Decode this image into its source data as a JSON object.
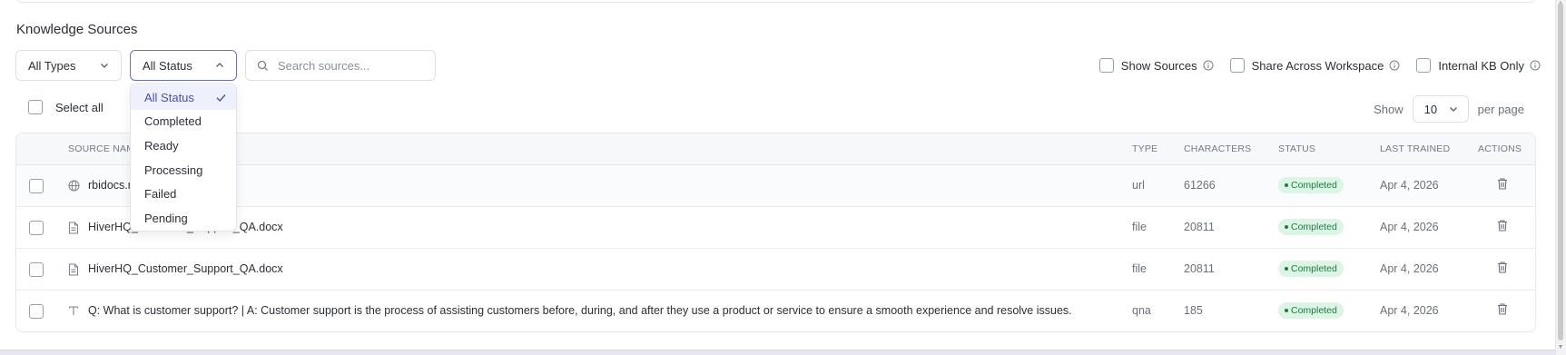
{
  "title": "Knowledge Sources",
  "filters": {
    "types_value": "All Types",
    "status_value": "All Status",
    "search_placeholder": "Search sources...",
    "status_options": [
      "All Status",
      "Completed",
      "Ready",
      "Processing",
      "Failed",
      "Pending"
    ],
    "status_selected": "All Status"
  },
  "toggles": {
    "show_sources": "Show Sources",
    "share_across_workspace": "Share Across Workspace",
    "internal_kb_only": "Internal KB Only"
  },
  "select_all_label": "Select all",
  "pagination": {
    "show_label": "Show",
    "per_page_value": "10",
    "per_page_label": "per page"
  },
  "table": {
    "headers": {
      "source_name": "SOURCE NAME",
      "type": "TYPE",
      "characters": "CHARACTERS",
      "status": "STATUS",
      "last_trained": "LAST TRAINED",
      "actions": "ACTIONS"
    },
    "rows": [
      {
        "icon": "globe-icon",
        "name": "rbidocs.rbi.org.in",
        "type": "url",
        "characters": "61266",
        "status": "Completed",
        "last_trained": "Apr 4, 2026"
      },
      {
        "icon": "file-icon",
        "name": "HiverHQ_Customer_Support_QA.docx",
        "type": "file",
        "characters": "20811",
        "status": "Completed",
        "last_trained": "Apr 4, 2026"
      },
      {
        "icon": "file-icon",
        "name": "HiverHQ_Customer_Support_QA.docx",
        "type": "file",
        "characters": "20811",
        "status": "Completed",
        "last_trained": "Apr 4, 2026"
      },
      {
        "icon": "text-icon",
        "name": "Q: What is customer support? | A: Customer support is the process of assisting customers before, during, and after they use a product or service to ensure a smooth experience and resolve issues.",
        "type": "qna",
        "characters": "185",
        "status": "Completed",
        "last_trained": "Apr 4, 2026"
      }
    ]
  },
  "colors": {
    "accent": "#4a4fb0",
    "status_completed_bg": "#dcf5e5",
    "status_completed_fg": "#1f7a45"
  }
}
